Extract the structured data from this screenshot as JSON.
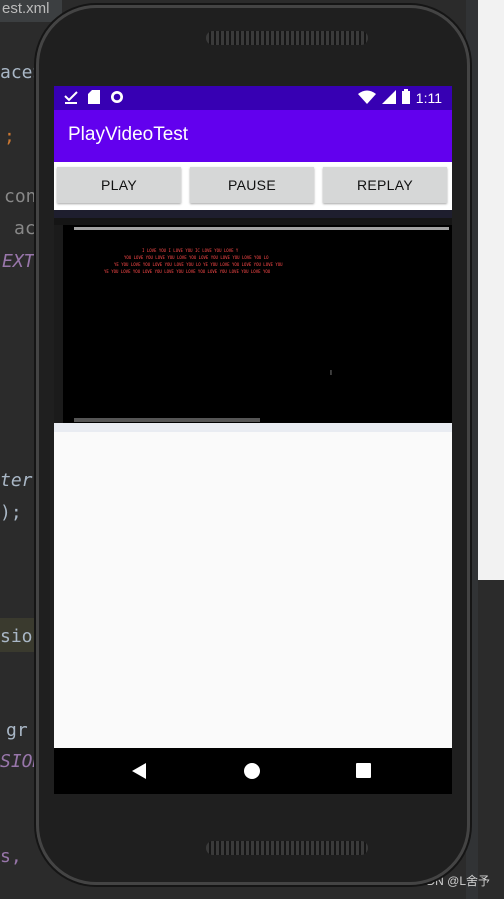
{
  "background": {
    "tab_label": "est.xml",
    "code_fragments": [
      "aceS",
      ";",
      "con",
      "act",
      "EXT",
      "ter",
      ");",
      "sion",
      "gr",
      "SION",
      "s,"
    ],
    "watermark": "CSDN @L舍予"
  },
  "status_bar": {
    "time": "1:11",
    "icons": [
      "download-done-icon",
      "sd-card-icon",
      "record-icon",
      "wifi-icon",
      "signal-icon",
      "battery-icon"
    ]
  },
  "app_bar": {
    "title": "PlayVideoTest"
  },
  "buttons": {
    "play": "PLAY",
    "pause": "PAUSE",
    "replay": "REPLAY"
  },
  "video": {
    "console_line_1": "I LOVE YOU  I LOVE YOU            IC LOVE YOU  LOVE Y",
    "console_line_2": "YOU LOVE YOU  LOVE YOU  LOVE YOU      LOVE YOU  LOVE YOU  LOVE YOU  LO",
    "console_line_3": "YE YOU  LOVE YOU  LOVE YOU  LOVE YOU  LO YE YOU  LOVE YOU  LOVE YOU  LOVE YOU",
    "console_line_4": "YE YOU  LOVE YOU  LOVE YOU  LOVE YOU  LOVE YOU  LOVE YOU  LOVE YOU  LOVE YOU"
  },
  "nav_bar": {
    "back": "back-icon",
    "home": "home-icon",
    "recents": "recents-icon"
  },
  "colors": {
    "status_bar": "#3700b3",
    "app_bar": "#6200ee",
    "button": "#d6d7d7"
  }
}
